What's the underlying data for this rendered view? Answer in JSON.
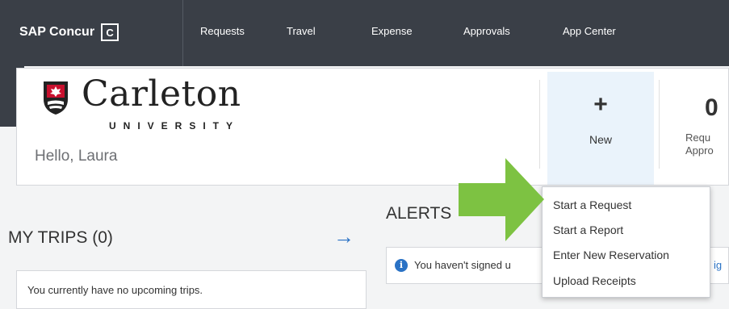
{
  "topnav": {
    "brand": "SAP Concur",
    "brand_icon": "C",
    "items": [
      "Requests",
      "Travel",
      "Expense",
      "Approvals",
      "App Center"
    ]
  },
  "header": {
    "logo_name": "Carleton",
    "logo_sub": "UNIVERSITY",
    "greeting": "Hello, Laura",
    "new_tile": {
      "icon": "+",
      "label": "New"
    },
    "requests_tile": {
      "count": "0",
      "label_line1": "Requ",
      "label_line2": "Appro"
    }
  },
  "trips": {
    "title": "MY TRIPS (0)",
    "message": "You currently have no upcoming trips."
  },
  "alerts": {
    "title": "ALERTS",
    "message": "You haven't signed u",
    "link": "ig"
  },
  "new_menu": {
    "items": [
      "Start a Request",
      "Start a Report",
      "Enter New Reservation",
      "Upload Receipts"
    ]
  },
  "colors": {
    "nav_bg": "#3a3f47",
    "accent_blue": "#2a72c5",
    "callout_green": "#7dc242",
    "crest_red": "#c8102e"
  }
}
